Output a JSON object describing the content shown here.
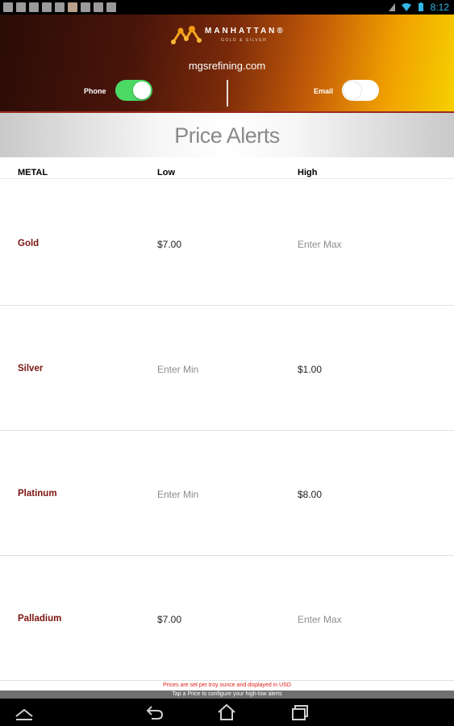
{
  "status_bar": {
    "time": "8:12",
    "left_icons": [
      "notification-icon",
      "file-icon",
      "image-icon",
      "mail-icon",
      "mail-icon",
      "photo-icon",
      "linkedin-icon",
      "cards-icon",
      "mail-icon"
    ],
    "right_icons": [
      "signal-icon",
      "wifi-icon",
      "battery-icon"
    ]
  },
  "header": {
    "logo_text": "MANHATTAN",
    "logo_registered": "®",
    "logo_sub": "GOLD & SILVER",
    "site": "mgsrefining.com",
    "phone_label": "Phone",
    "phone_enabled": true,
    "email_label": "Email",
    "email_enabled": false
  },
  "title": "Price Alerts",
  "columns": {
    "metal": "METAL",
    "low": "Low",
    "high": "High"
  },
  "rows": [
    {
      "metal": "Gold",
      "low": "$7.00",
      "low_placeholder": false,
      "high": "Enter Max",
      "high_placeholder": true
    },
    {
      "metal": "Silver",
      "low": "Enter Min",
      "low_placeholder": true,
      "high": "$1.00",
      "high_placeholder": false
    },
    {
      "metal": "Platinum",
      "low": "Enter Min",
      "low_placeholder": true,
      "high": "$8.00",
      "high_placeholder": false
    },
    {
      "metal": "Palladium",
      "low": "$7.00",
      "low_placeholder": false,
      "high": "Enter Max",
      "high_placeholder": true
    }
  ],
  "footer": {
    "note": "Prices are set per troy ounce and displayed in USD",
    "hint": "Tap a Price to configure your high-low alerts"
  },
  "colors": {
    "metal_text": "#7a1410",
    "toggle_on": "#4cd964",
    "footer_note": "#e0201a",
    "status_accent": "#33b5e5"
  },
  "navbar": {
    "icons": [
      "up-icon",
      "back-icon",
      "home-icon",
      "recent-apps-icon"
    ]
  }
}
